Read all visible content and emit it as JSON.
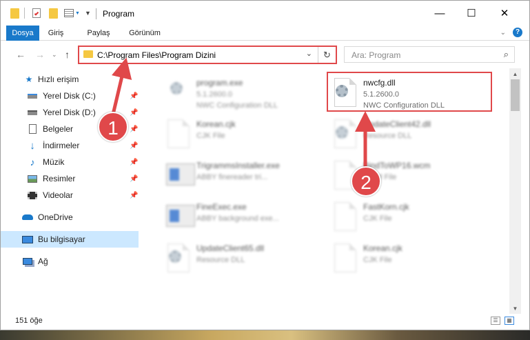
{
  "window": {
    "title": "Program",
    "controls": {
      "minimize": "—",
      "maximize": "☐",
      "close": "✕"
    }
  },
  "ribbon": {
    "tabs": [
      {
        "label": "Dosya",
        "active": true
      },
      {
        "label": "Giriş",
        "active": false
      },
      {
        "label": "Paylaş",
        "active": false
      },
      {
        "label": "Görünüm",
        "active": false
      }
    ],
    "help": "?"
  },
  "address": {
    "path": "C:\\Program Files\\Program Dizini",
    "search_placeholder": "Ara: Program"
  },
  "sidebar": {
    "items": [
      {
        "label": "Hızlı erişim",
        "icon": "star-icon",
        "pinned": false
      },
      {
        "label": "Yerel Disk (C:)",
        "icon": "drive-icon",
        "pinned": true
      },
      {
        "label": "Yerel Disk (D:)",
        "icon": "drive-icon",
        "pinned": true
      },
      {
        "label": "Belgeler",
        "icon": "documents-icon",
        "pinned": true
      },
      {
        "label": "İndirmeler",
        "icon": "download-icon",
        "pinned": true
      },
      {
        "label": "Müzik",
        "icon": "music-icon",
        "pinned": true
      },
      {
        "label": "Resimler",
        "icon": "pictures-icon",
        "pinned": true
      },
      {
        "label": "Videolar",
        "icon": "videos-icon",
        "pinned": true
      },
      {
        "label": "OneDrive",
        "icon": "cloud-icon",
        "pinned": false
      },
      {
        "label": "Bu bilgisayar",
        "icon": "computer-icon",
        "pinned": false,
        "selected": true
      },
      {
        "label": "Ağ",
        "icon": "network-icon",
        "pinned": false
      }
    ]
  },
  "files": [
    {
      "name": "program.exe",
      "line2": "5.1.2600.0",
      "line3": "NWC Configuration DLL",
      "icon": "exe-icon",
      "blurred": true
    },
    {
      "name": "nwcfg.dll",
      "line2": "5.1.2600.0",
      "line3": "NWC Configuration DLL",
      "icon": "dll-icon",
      "blurred": false,
      "highlighted": true
    },
    {
      "name": "Korean.cjk",
      "line2": "CJK File",
      "line3": "",
      "icon": "file-icon",
      "blurred": true
    },
    {
      "name": "UpdateClient42.dll",
      "line2": "Resource DLL",
      "line3": "",
      "icon": "dll-icon",
      "blurred": true
    },
    {
      "name": "TrigrammsInstaller.exe",
      "line2": "ABBY finereader tri...",
      "line3": "",
      "icon": "app-icon",
      "blurred": true
    },
    {
      "name": "BindToWP16.wcm",
      "line2": "WCM File",
      "line3": "",
      "icon": "file-icon",
      "blurred": true
    },
    {
      "name": "FineExec.exe",
      "line2": "ABBY background exe...",
      "line3": "",
      "icon": "app-icon",
      "blurred": true
    },
    {
      "name": "FastKorn.cjk",
      "line2": "CJK File",
      "line3": "",
      "icon": "file-icon",
      "blurred": true
    },
    {
      "name": "UpdateClient65.dll",
      "line2": "Resource DLL",
      "line3": "",
      "icon": "dll-icon",
      "blurred": true
    },
    {
      "name": "Korean.cjk",
      "line2": "CJK File",
      "line3": "",
      "icon": "file-icon",
      "blurred": true
    }
  ],
  "status": {
    "count": "151 öğe"
  },
  "callouts": {
    "one": "1",
    "two": "2"
  },
  "colors": {
    "accent": "#1979ca",
    "highlight": "#e0484a",
    "selection": "#cce8ff"
  }
}
